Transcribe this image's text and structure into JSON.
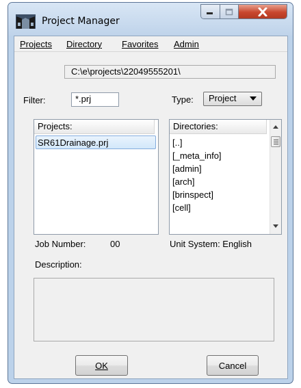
{
  "window": {
    "title": "Project Manager"
  },
  "menu": [
    {
      "label": "Projects"
    },
    {
      "label": "Directory"
    },
    {
      "label": "Favorites"
    },
    {
      "label": "Admin"
    }
  ],
  "path": "C:\\e\\projects\\22049555201\\",
  "filter": {
    "label": "Filter:",
    "value": "*.prj"
  },
  "type": {
    "label": "Type:",
    "selected": "Project"
  },
  "projects_list": {
    "header": "Projects:",
    "items": [
      "SR61Drainage.prj"
    ]
  },
  "directories_list": {
    "header": "Directories:",
    "items": [
      "[..]",
      "[_meta_info]",
      "[admin]",
      "[arch]",
      "[brinspect]",
      "[cell]"
    ]
  },
  "job_number": {
    "label": "Job Number:",
    "value": "00"
  },
  "unit_system": {
    "label": "Unit System: English"
  },
  "description": {
    "label": "Description:",
    "value": ""
  },
  "buttons": {
    "ok_label": "OK",
    "cancel_label": "Cancel"
  },
  "colors": {
    "frame": "#bcd2ea",
    "client": "#f0f0f0",
    "close_button": "#c8472e",
    "selection_border": "#84acdd"
  },
  "icons": {
    "app": "project-manager-icon",
    "minimize": "minimize-icon",
    "maximize": "maximize-icon",
    "close": "close-icon"
  }
}
